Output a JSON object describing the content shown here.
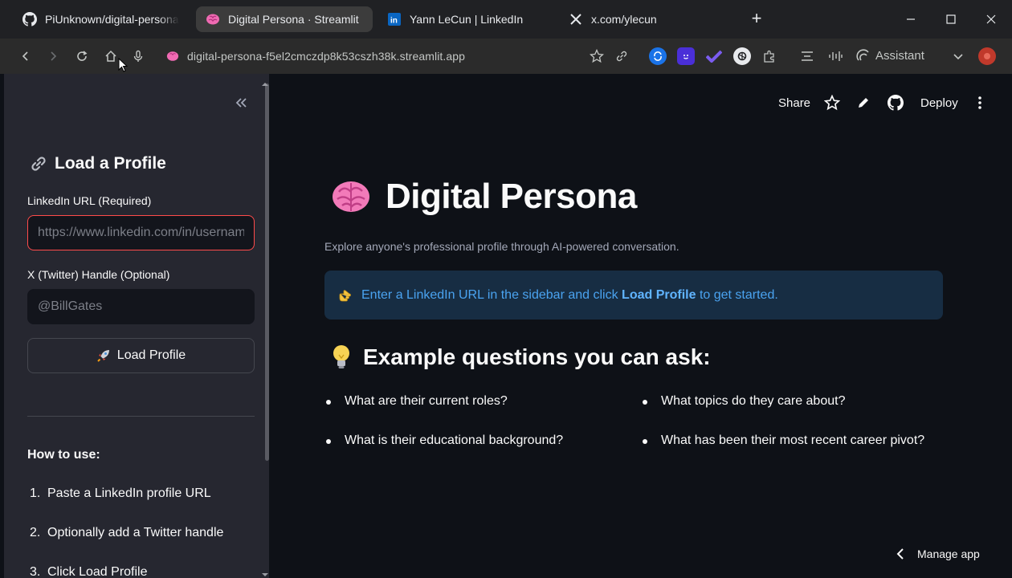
{
  "browser": {
    "tabs": [
      {
        "label": "PiUnknown/digital-persona",
        "icon": "github-icon"
      },
      {
        "label": "Digital Persona · Streamlit",
        "icon": "brain-icon"
      },
      {
        "label": "Yann LeCun | LinkedIn",
        "icon": "linkedin-icon"
      },
      {
        "label": "x.com/ylecun",
        "icon": "x-icon"
      }
    ],
    "new_tab": "+",
    "url": "digital-persona-f5el2cmczdp8k53cszh38k.streamlit.app",
    "assistant_label": "Assistant"
  },
  "sidebar": {
    "heading": "Load a Profile",
    "linkedin_label": "LinkedIn URL (Required)",
    "linkedin_placeholder": "https://www.linkedin.com/in/username",
    "twitter_label": "X (Twitter) Handle (Optional)",
    "twitter_placeholder": "@BillGates",
    "load_button": "Load Profile",
    "howto_title": "How to use:",
    "steps": [
      {
        "num": "1.",
        "text": "Paste a LinkedIn profile URL"
      },
      {
        "num": "2.",
        "text": "Optionally add a Twitter handle"
      },
      {
        "num": "3.",
        "text": "Click Load Profile"
      }
    ]
  },
  "header": {
    "share": "Share",
    "deploy": "Deploy"
  },
  "main": {
    "title": "Digital Persona",
    "subtitle": "Explore anyone's professional profile through AI-powered conversation.",
    "info_pre": "Enter a LinkedIn URL in the sidebar and click",
    "info_bold": "Load Profile",
    "info_post": "to get started.",
    "examples_title": "Example questions you can ask:",
    "questions": [
      "What are their current roles?",
      "What topics do they care about?",
      "What is their educational background?",
      "What has been their most recent career pivot?"
    ]
  },
  "footer": {
    "manage_app": "Manage app"
  },
  "colors": {
    "accent": "#ff4b4b",
    "info_bg": "#172d43",
    "info_text": "#4aa3f0",
    "page_bg": "#0e1117",
    "sidebar_bg": "#262730"
  }
}
